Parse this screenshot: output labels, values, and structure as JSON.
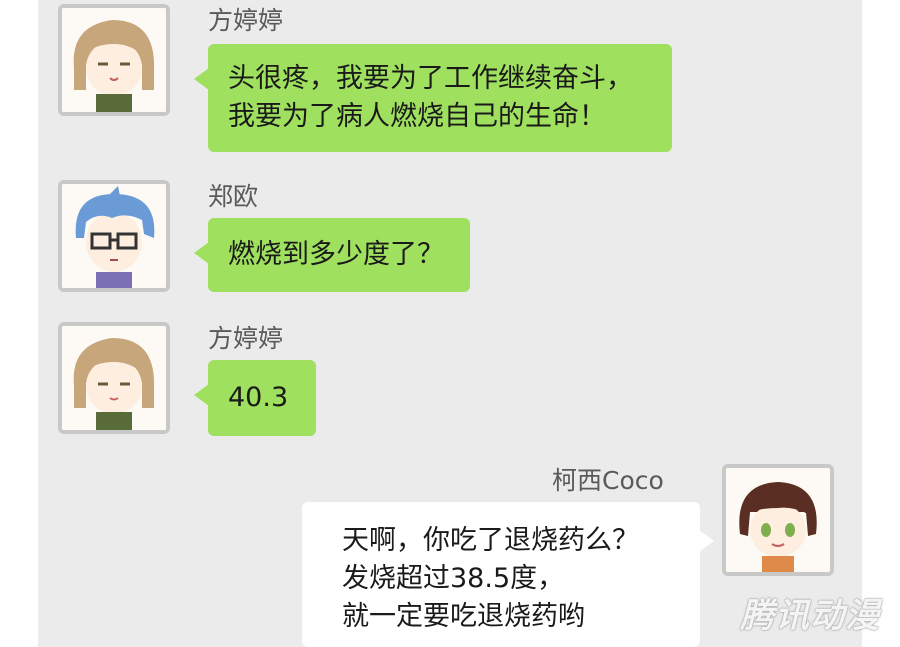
{
  "messages": [
    {
      "sender": "方婷婷",
      "side": "left",
      "lines": [
        "头很疼，我要为了工作继续奋斗，",
        "我要为了病人燃烧自己的生命！"
      ]
    },
    {
      "sender": "郑欧",
      "side": "left",
      "lines": [
        "燃烧到多少度了？"
      ]
    },
    {
      "sender": "方婷婷",
      "side": "left",
      "lines": [
        "40.3"
      ]
    },
    {
      "sender": "柯西Coco",
      "side": "right",
      "lines": [
        "天啊，你吃了退烧药么？",
        "发烧超过38.5度，",
        "就一定要吃退烧药哟"
      ]
    }
  ],
  "watermark": "腾讯动漫",
  "colors": {
    "panel_bg": "#ebebeb",
    "bubble_green": "#9fe05e",
    "bubble_white": "#ffffff",
    "avatar_border": "#c8c8c8"
  },
  "icons": {
    "avatar_1": "girl-light-brown-hair-avatar-icon",
    "avatar_2": "boy-blue-hair-glasses-avatar-icon",
    "avatar_3": "girl-light-brown-hair-avatar-icon",
    "avatar_4": "girl-dark-brown-hair-green-eyes-avatar-icon"
  }
}
